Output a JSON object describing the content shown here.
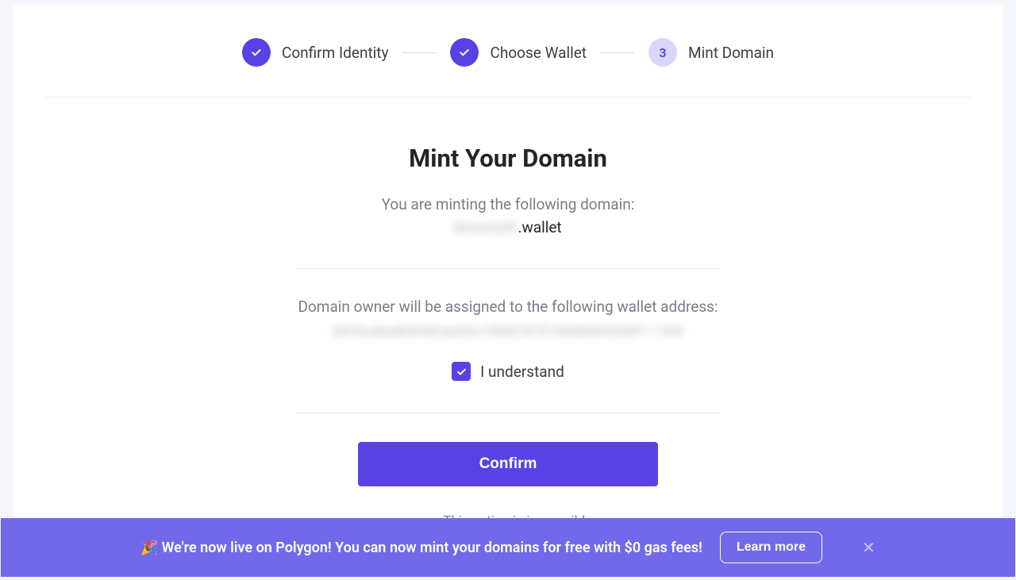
{
  "stepper": {
    "steps": [
      {
        "label": "Confirm Identity",
        "state": "done"
      },
      {
        "label": "Choose Wallet",
        "state": "done"
      },
      {
        "label": "Mint Domain",
        "state": "current",
        "number": "3"
      }
    ]
  },
  "main": {
    "title": "Mint Your Domain",
    "minting_intro": "You are minting the following domain:",
    "domain_prefix_blurred": "bmumyth",
    "domain_suffix": ".wallet",
    "owner_intro": "Domain owner will be assigned to the following wallet address:",
    "wallet_address_blurred": "0xF0ca8adh0HB2ae03c19BAC4751A08B304330F1-13Ht",
    "understand_label": "I understand",
    "understand_checked": true,
    "confirm_label": "Confirm",
    "warning_text": "This action is irreversible"
  },
  "banner": {
    "emoji": "🎉",
    "text": "We're now live on Polygon! You can now mint your domains for free with $0 gas fees!",
    "learn_more_label": "Learn more"
  },
  "colors": {
    "accent": "#5842e3",
    "banner_bg": "#7169ea"
  }
}
